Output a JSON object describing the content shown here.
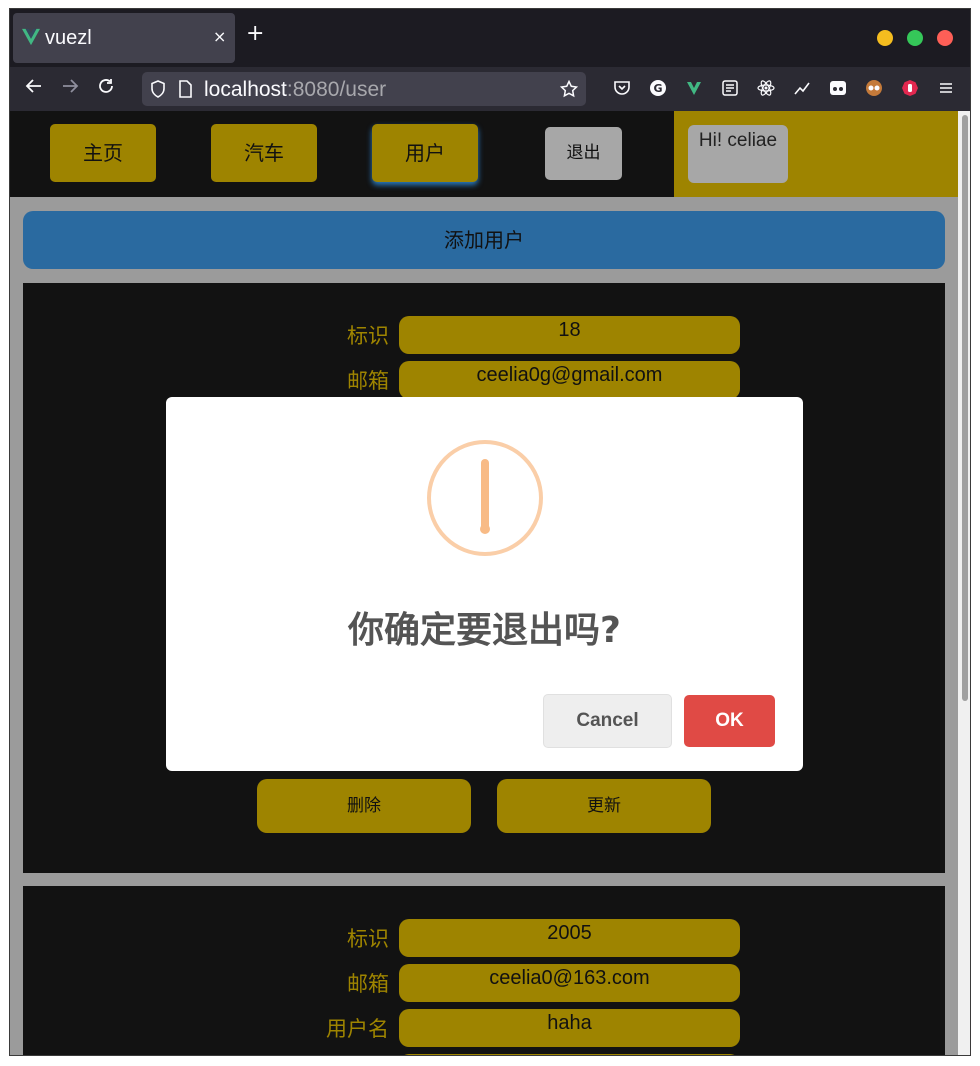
{
  "browser": {
    "tab_title": "vuezl",
    "tab_close": "×",
    "new_tab": "+",
    "url_host": "localhost",
    "url_rest": ":8080/user",
    "window_colors": {
      "minimize": "#f5bd1f",
      "maximize": "#35c759",
      "close": "#fe5f57"
    }
  },
  "topnav": {
    "items": [
      {
        "label": "主页"
      },
      {
        "label": "汽车"
      },
      {
        "label": "用户"
      }
    ],
    "logout_label": "退出",
    "greeting": "Hi! celiae"
  },
  "main": {
    "add_user_label": "添加用户",
    "cards": [
      {
        "fields": [
          {
            "label": "标识",
            "value": "18"
          },
          {
            "label": "邮箱",
            "value": "ceelia0g@gmail.com"
          }
        ],
        "delete_label": "删除",
        "update_label": "更新"
      },
      {
        "fields": [
          {
            "label": "标识",
            "value": "2005"
          },
          {
            "label": "邮箱",
            "value": "ceelia0@163.com"
          },
          {
            "label": "用户名",
            "value": "haha"
          }
        ]
      }
    ]
  },
  "dialog": {
    "icon": "warning-icon",
    "title": "你确定要退出吗?",
    "cancel_label": "Cancel",
    "ok_label": "OK"
  },
  "colors": {
    "accent_gold": "#9e8400",
    "add_button_blue": "#2a6aa0",
    "ok_red": "#e04a45",
    "warning_orange": "#f8bb86"
  }
}
